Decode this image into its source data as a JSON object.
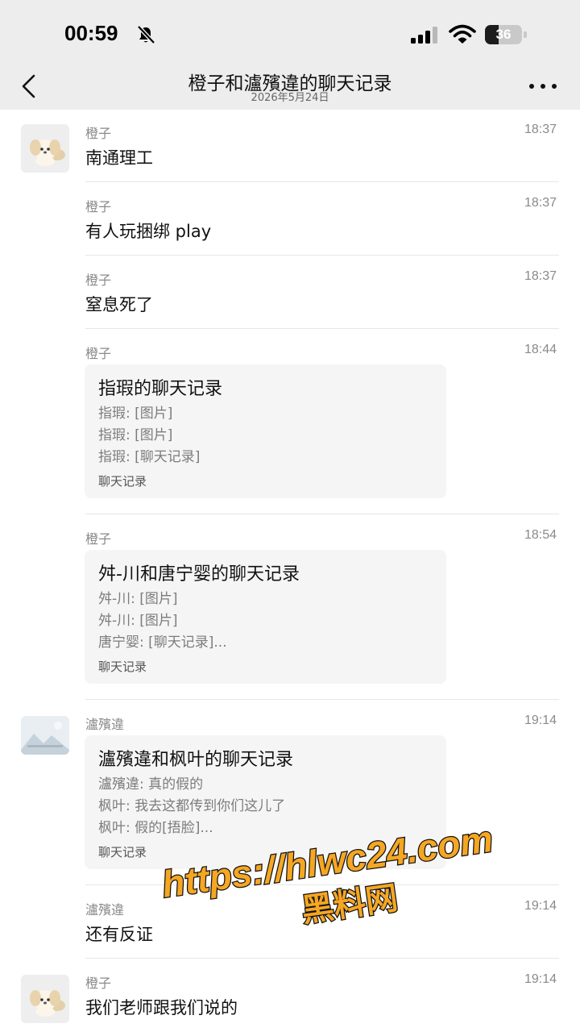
{
  "status_bar": {
    "time": "00:59",
    "battery_level": "36",
    "battery_fraction": 0.36
  },
  "header": {
    "back_icon": "chevron-left-icon",
    "title": "橙子和瀘殯違的聊天记录",
    "subtitle": "2026年5月24日",
    "more_icon": "more-dots-icon"
  },
  "messages": [
    {
      "sender": "橙子",
      "time": "18:37",
      "text": "南通理工"
    },
    {
      "sender": "橙子",
      "time": "18:37",
      "text": "有人玩捆绑 play"
    },
    {
      "sender": "橙子",
      "time": "18:37",
      "text": "窒息死了"
    },
    {
      "sender": "橙子",
      "time": "18:44",
      "card": {
        "title": "指瑕的聊天记录",
        "lines": [
          "指瑕: [图片]",
          "指瑕: [图片]",
          "指瑕: [聊天记录]"
        ],
        "footer": "聊天记录"
      }
    },
    {
      "sender": "橙子",
      "time": "18:54",
      "card": {
        "title": "舛-川和唐宁婴的聊天记录",
        "lines": [
          "舛-川: [图片]",
          "舛-川: [图片]",
          "唐宁婴: [聊天记录]..."
        ],
        "footer": "聊天记录"
      }
    },
    {
      "sender": "瀘殯違",
      "time": "19:14",
      "card": {
        "title": "瀘殯違和枫叶的聊天记录",
        "lines": [
          "瀘殯違: 真的假的",
          "枫叶: 我去这都传到你们这儿了",
          "枫叶: 假的[捂脸]..."
        ],
        "footer": "聊天记录"
      }
    },
    {
      "sender": "瀘殯違",
      "time": "19:14",
      "text": "还有反证"
    },
    {
      "sender": "橙子",
      "time": "19:14",
      "text": "我们老师跟我们说的"
    }
  ],
  "watermark": {
    "line1": "https://hlwc24.com",
    "line2": "黑料网"
  },
  "colors": {
    "header_bg": "#ededed",
    "card_bg": "#f5f5f5",
    "watermark_fill": "#f5a623"
  }
}
